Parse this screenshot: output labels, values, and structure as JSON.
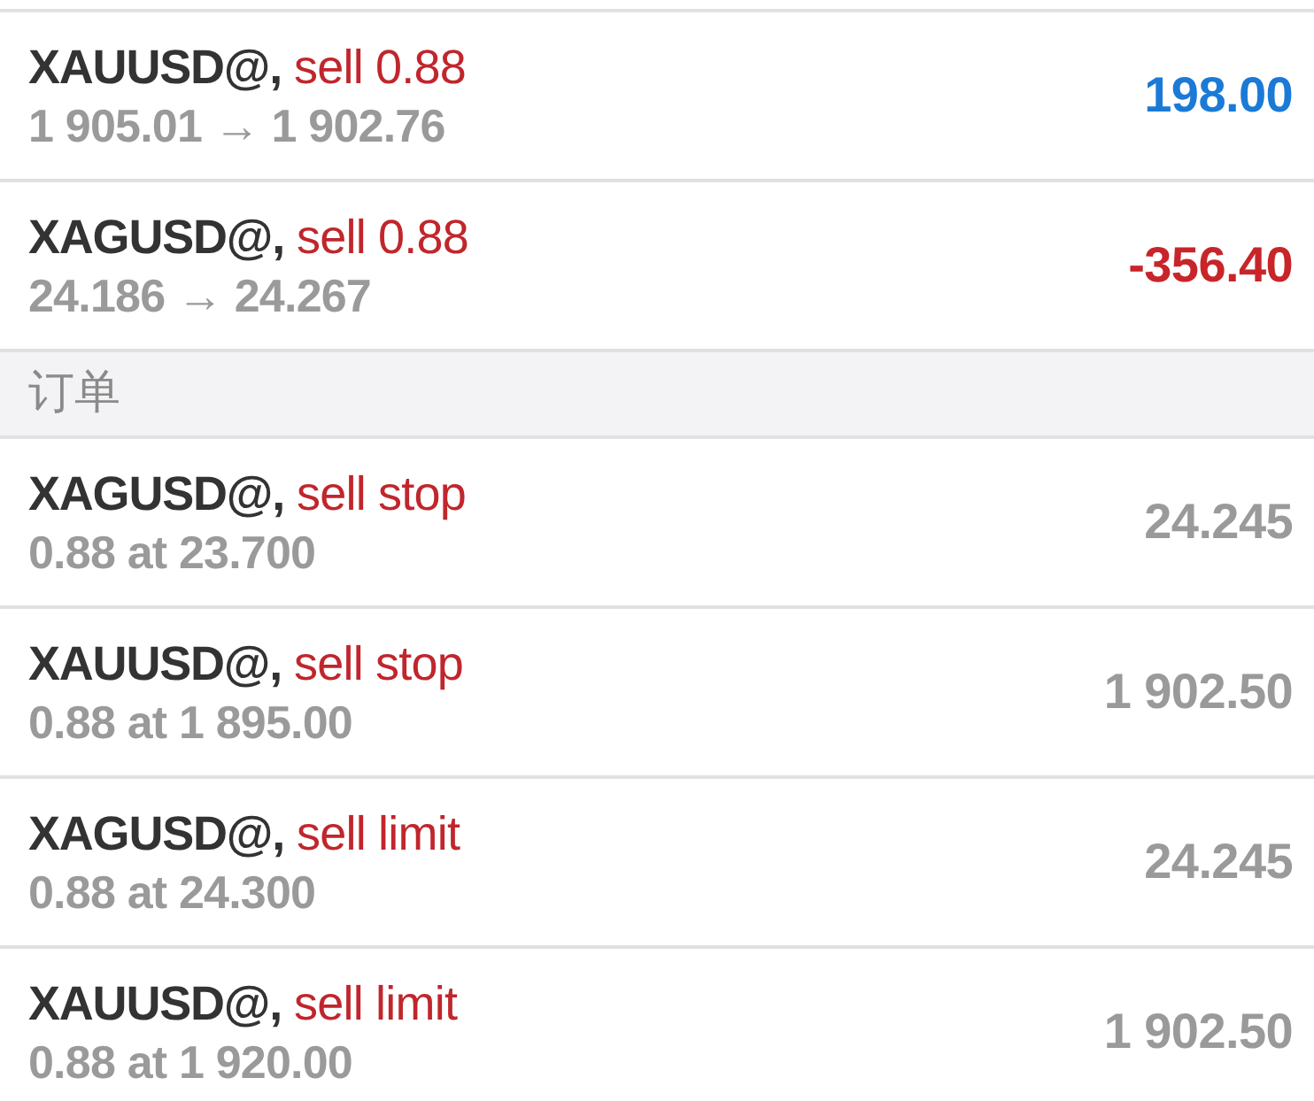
{
  "positions": [
    {
      "symbol": "XAUUSD@,",
      "type": "sell 0.88",
      "prices": "1 905.01 → 1 902.76",
      "profit": "198.00",
      "color": "#1a7ad6"
    },
    {
      "symbol": "XAGUSD@,",
      "type": "sell 0.88",
      "prices": "24.186 → 24.267",
      "profit": "-356.40",
      "color": "#c8252b"
    }
  ],
  "orders_section": {
    "title": "订单"
  },
  "orders": [
    {
      "symbol": "XAGUSD@,",
      "type": "sell stop",
      "details": "0.88 at 23.700",
      "price": "24.245"
    },
    {
      "symbol": "XAUUSD@,",
      "type": "sell stop",
      "details": "0.88 at 1 895.00",
      "price": "1 902.50"
    },
    {
      "symbol": "XAGUSD@,",
      "type": "sell limit",
      "details": "0.88 at 24.300",
      "price": "24.245"
    },
    {
      "symbol": "XAUUSD@,",
      "type": "sell limit",
      "details": "0.88 at 1 920.00",
      "price": "1 902.50"
    }
  ]
}
